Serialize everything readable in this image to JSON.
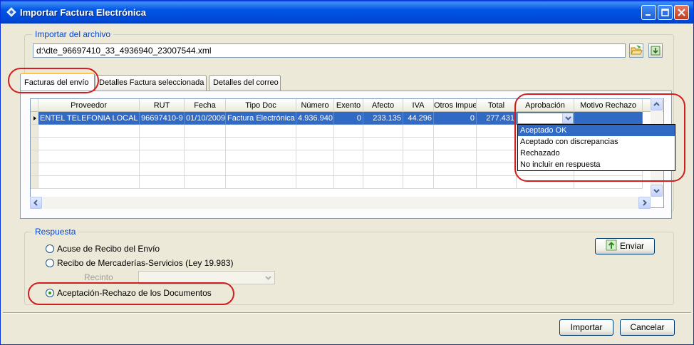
{
  "window": {
    "title": "Importar Factura Electrónica"
  },
  "import_group": {
    "label": "Importar del archivo",
    "file_path": "d:\\dte_96697410_33_4936940_23007544.xml"
  },
  "tabs": [
    {
      "label": "Facturas del envío",
      "active": true
    },
    {
      "label": "Detalles Factura seleccionada",
      "active": false
    },
    {
      "label": "Detalles del correo",
      "active": false
    }
  ],
  "grid": {
    "columns": [
      "Proveedor",
      "RUT",
      "Fecha",
      "Tipo Doc",
      "Número",
      "Exento",
      "Afecto",
      "IVA",
      "Otros Impue",
      "Total",
      "Aprobación",
      "Motivo Rechazo"
    ],
    "rows": [
      {
        "proveedor": "ENTEL TELEFONIA LOCAL S.",
        "rut": "96697410-9",
        "fecha": "01/10/2009",
        "tipo_doc": "Factura Electrónica",
        "numero": "4.936.940",
        "exento": "0",
        "afecto": "233.135",
        "iva": "44.296",
        "otros": "0",
        "total": "277.431",
        "aprobacion": "",
        "motivo": ""
      }
    ]
  },
  "aprobacion_dropdown": {
    "options": [
      "Aceptado OK",
      "Aceptado con discrepancias",
      "Rechazado",
      "No incluir en respuesta"
    ],
    "highlighted_index": 0
  },
  "respuesta_group": {
    "label": "Respuesta",
    "options": [
      {
        "label": "Acuse de Recibo del Envío",
        "selected": false
      },
      {
        "label": "Recibo de Mercaderías-Servicios (Ley 19.983)",
        "selected": false
      },
      {
        "label": "Aceptación-Rechazo de los Documentos",
        "selected": true
      }
    ],
    "recinto_label": "Recinto",
    "recinto_value": ""
  },
  "buttons": {
    "enviar": "Enviar",
    "importar": "Importar",
    "cancelar": "Cancelar"
  },
  "colors": {
    "title_bar": "#0055E5",
    "selection": "#316AC5",
    "annotation": "#D21E1E",
    "group_label": "#0046D5"
  }
}
